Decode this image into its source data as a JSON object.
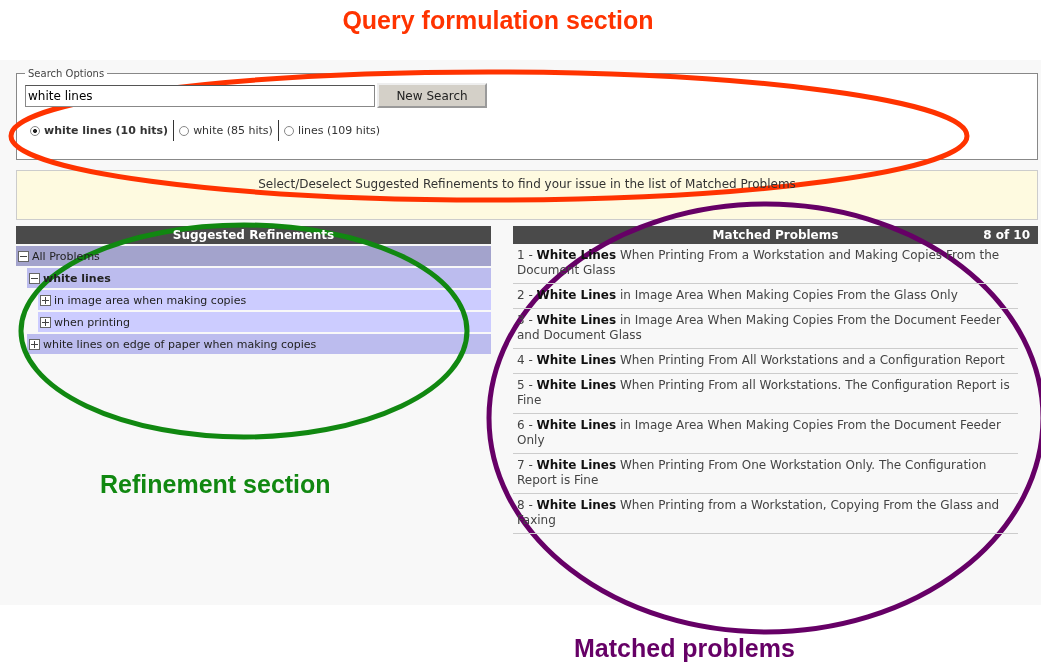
{
  "annotations": [
    {
      "label": "Query formulation section",
      "color": "#ff3300"
    },
    {
      "label": "Refinement section",
      "color": "#118811"
    },
    {
      "label": "Matched problems",
      "color": "#660066"
    }
  ],
  "search_options": {
    "legend": "Search Options",
    "query": "white lines",
    "button": "New Search",
    "options": [
      {
        "label": "white lines (10 hits)",
        "selected": true
      },
      {
        "label": "white (85 hits)",
        "selected": false
      },
      {
        "label": "lines (109 hits)",
        "selected": false
      }
    ]
  },
  "hint": "Select/Deselect Suggested Refinements to find your issue in the list of Matched Problems",
  "refinements": {
    "title": "Suggested Refinements",
    "items": [
      {
        "label": "All Problems",
        "expanded": true,
        "selected": false,
        "children": [
          {
            "label": "white lines",
            "expanded": true,
            "selected": true,
            "children": [
              {
                "label": "in image area when making copies",
                "expanded": false,
                "selected": false
              },
              {
                "label": "when printing",
                "expanded": false,
                "selected": false
              }
            ]
          },
          {
            "label": "white lines on edge of paper when making copies",
            "expanded": false,
            "selected": false
          }
        ]
      }
    ]
  },
  "matched": {
    "title": "Matched Problems",
    "count": "8 of 10",
    "rows": [
      "1 - **White Lines** When Printing From a Workstation and Making Copies From the Document Glass",
      "2 - **White Lines** in Image Area When Making Copies From the Glass Only",
      "3 - **White Lines** in Image Area When Making Copies From the Document Feeder and Document Glass",
      "4 - **White Lines** When Printing From All Workstations and a Configuration Report",
      "5 - **White Lines** When Printing From all Workstations. The Configuration Report is Fine",
      "6 - **White Lines** in Image Area When Making Copies From the Document Feeder Only",
      "7 - **White Lines** When Printing From One Workstation Only. The Configuration Report is Fine",
      "8 - **White Lines** When Printing from a Workstation, Copying From the Glass and Faxing"
    ]
  }
}
